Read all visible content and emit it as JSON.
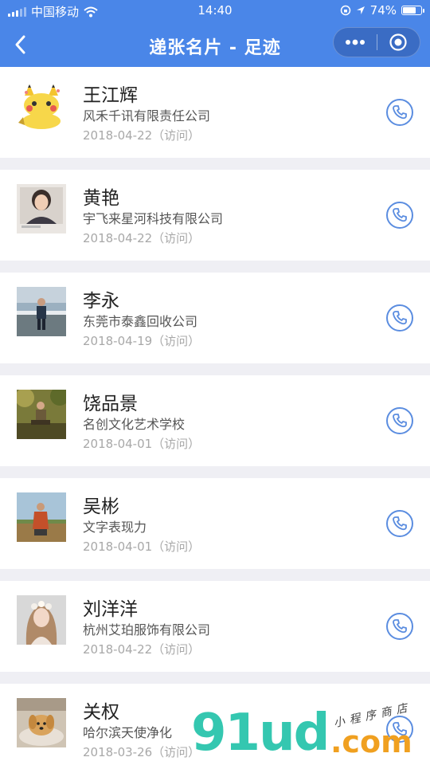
{
  "status_bar": {
    "carrier": "中国移动",
    "time": "14:40",
    "battery_text": "74%",
    "battery_level": 0.74,
    "icons": [
      "signal-icon",
      "wifi-icon",
      "lock-rotation-icon",
      "location-icon",
      "battery-icon"
    ]
  },
  "nav": {
    "title": "递张名片 - 足迹",
    "back_icon": "chevron-left-icon",
    "more_icon": "more-dots-icon",
    "close_icon": "target-icon",
    "bar_color": "#4a86e8"
  },
  "cards": [
    {
      "name": "王江辉",
      "company": "风禾千讯有限责任公司",
      "date": "2018-04-22（访问）",
      "avatar": "pikachu-cartoon"
    },
    {
      "name": "黄艳",
      "company": "宇飞来星河科技有限公司",
      "date": "2018-04-22（访问）",
      "avatar": "portrait-woman"
    },
    {
      "name": "李永",
      "company": "东莞市泰鑫回收公司",
      "date": "2018-04-19（访问）",
      "avatar": "man-outdoor"
    },
    {
      "name": "饶品景",
      "company": "名创文化艺术学校",
      "date": "2018-04-01（访问）",
      "avatar": "man-sitting-garden"
    },
    {
      "name": "吴彬",
      "company": "文字表现力",
      "date": "2018-04-01（访问）",
      "avatar": "man-field"
    },
    {
      "name": "刘洋洋",
      "company": "杭州艾珀服饰有限公司",
      "date": "2018-04-22（访问）",
      "avatar": "woman-flower-crown"
    },
    {
      "name": "关权",
      "company": "哈尔滨天使净化",
      "date": "2018-03-26（访问）",
      "avatar": "puppy"
    }
  ],
  "call_icon": "phone-icon",
  "accent_color": "#5b8de0",
  "watermark": {
    "main": "91ud",
    "domain": ".com",
    "sub": "小程序商店"
  }
}
